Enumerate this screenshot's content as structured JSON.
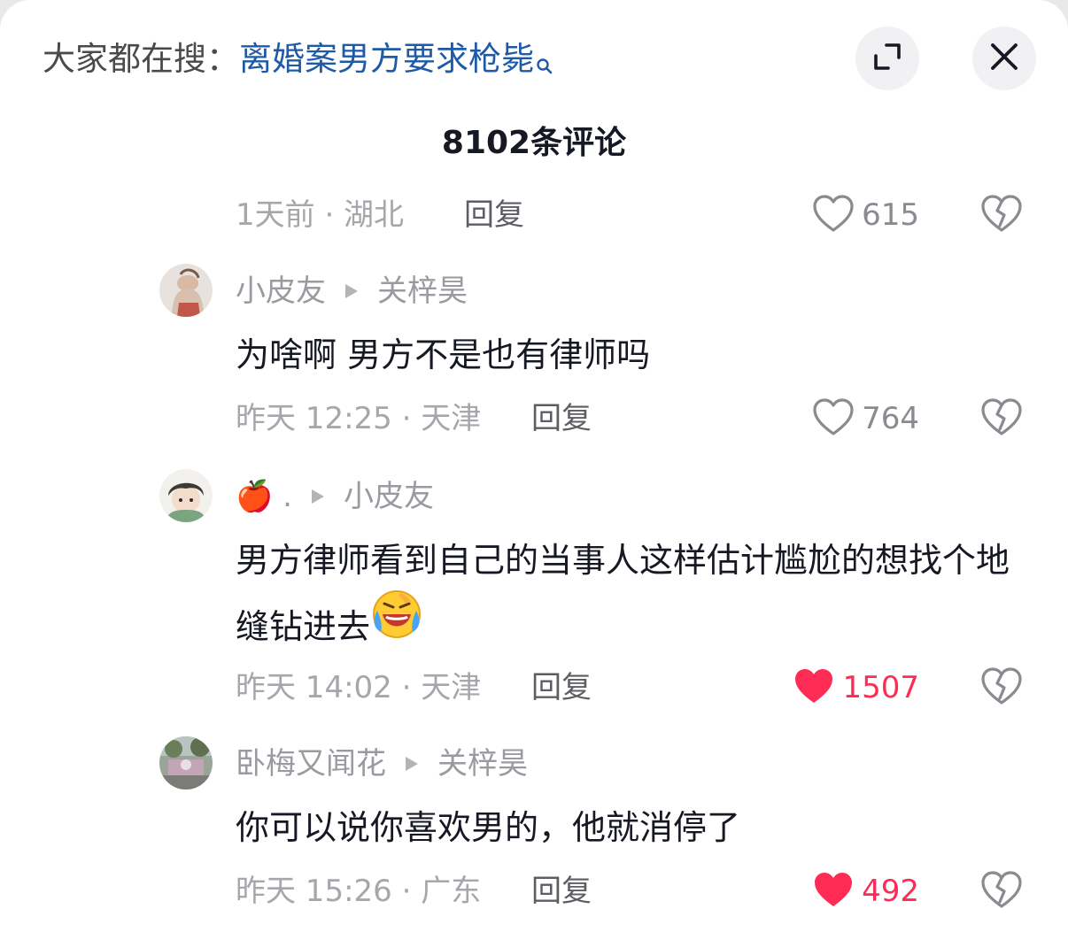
{
  "header": {
    "hot_search_prefix": "大家都在搜：",
    "hot_search_query": "离婚案男方要求枪毙",
    "comment_count_title": "8102条评论"
  },
  "colors": {
    "liked": "#fe2c55",
    "link_blue": "#1e5aa8"
  },
  "comments": [
    {
      "meta": "1天前 · 湖北",
      "reply_label": "回复",
      "likes": "615",
      "liked": false
    },
    {
      "author": "小皮友",
      "reply_to": "关梓昊",
      "text": "为啥啊 男方不是也有律师吗",
      "meta": "昨天 12:25 · 天津",
      "reply_label": "回复",
      "likes": "764",
      "liked": false
    },
    {
      "author": "🍎 .",
      "reply_to": "小皮友",
      "text": "男方律师看到自己的当事人这样估计尴尬的想找个地缝钻进去",
      "emoji": "crying-laughing-emoji",
      "meta": "昨天 14:02 · 天津",
      "reply_label": "回复",
      "likes": "1507",
      "liked": true
    },
    {
      "author": "卧梅又闻花",
      "reply_to": "关梓昊",
      "text": "你可以说你喜欢男的，他就消停了",
      "meta": "昨天 15:26 · 广东",
      "reply_label": "回复",
      "likes": "492",
      "liked": true
    }
  ],
  "icons": {
    "search": "search-icon",
    "expand": "expand-icon",
    "close": "close-icon",
    "like": "heart-icon",
    "dislike": "broken-heart-icon",
    "reply_arrow": "play-triangle-icon"
  }
}
